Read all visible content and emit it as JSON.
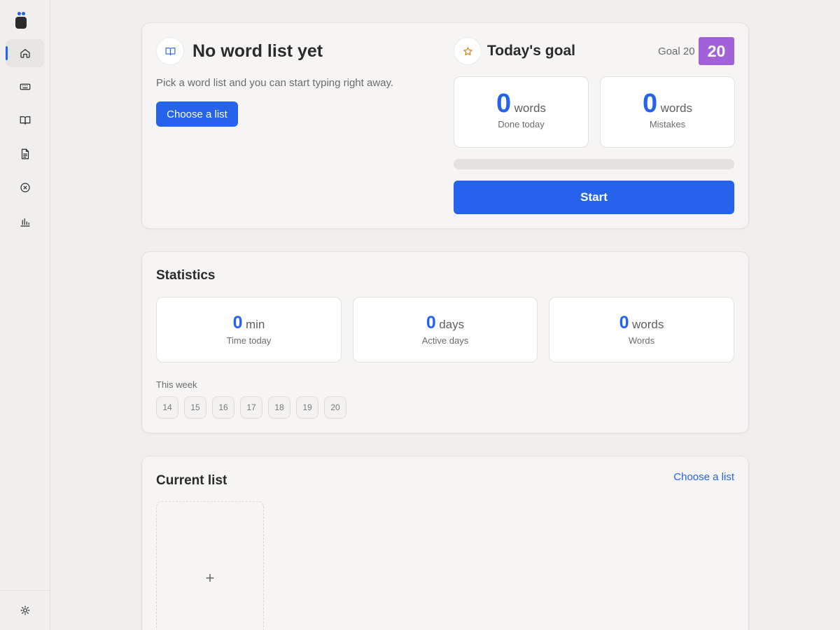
{
  "sidebar": {
    "items": [
      {
        "icon": "home-icon",
        "active": true
      },
      {
        "icon": "keyboard-icon",
        "active": false
      },
      {
        "icon": "book-icon",
        "active": false
      },
      {
        "icon": "document-icon",
        "active": false
      },
      {
        "icon": "x-circle-icon",
        "active": false
      },
      {
        "icon": "bar-chart-icon",
        "active": false
      }
    ],
    "bottom_icon": "sun-icon"
  },
  "word_list": {
    "title": "No word list yet",
    "description": "Pick a word list and you can start typing right away.",
    "choose_button": "Choose a list"
  },
  "goal": {
    "title": "Today's goal",
    "goal_label": "Goal 20",
    "goal_badge": "20",
    "boxes": [
      {
        "value": "0",
        "unit": "words",
        "caption": "Done today"
      },
      {
        "value": "0",
        "unit": "words",
        "caption": "Mistakes"
      }
    ],
    "progress": 0,
    "start_button": "Start"
  },
  "statistics": {
    "title": "Statistics",
    "boxes": [
      {
        "value": "0",
        "unit": "min",
        "caption": "Time today"
      },
      {
        "value": "0",
        "unit": "days",
        "caption": "Active days"
      },
      {
        "value": "0",
        "unit": "words",
        "caption": "Words"
      }
    ],
    "week_label": "This week",
    "week_days": [
      "14",
      "15",
      "16",
      "17",
      "18",
      "19",
      "20"
    ]
  },
  "current_list": {
    "title": "Current list",
    "choose_link": "Choose a list",
    "add_symbol": "+"
  },
  "colors": {
    "accent": "#2563eb",
    "goal_badge": "#a062d6",
    "star": "#d97706"
  }
}
